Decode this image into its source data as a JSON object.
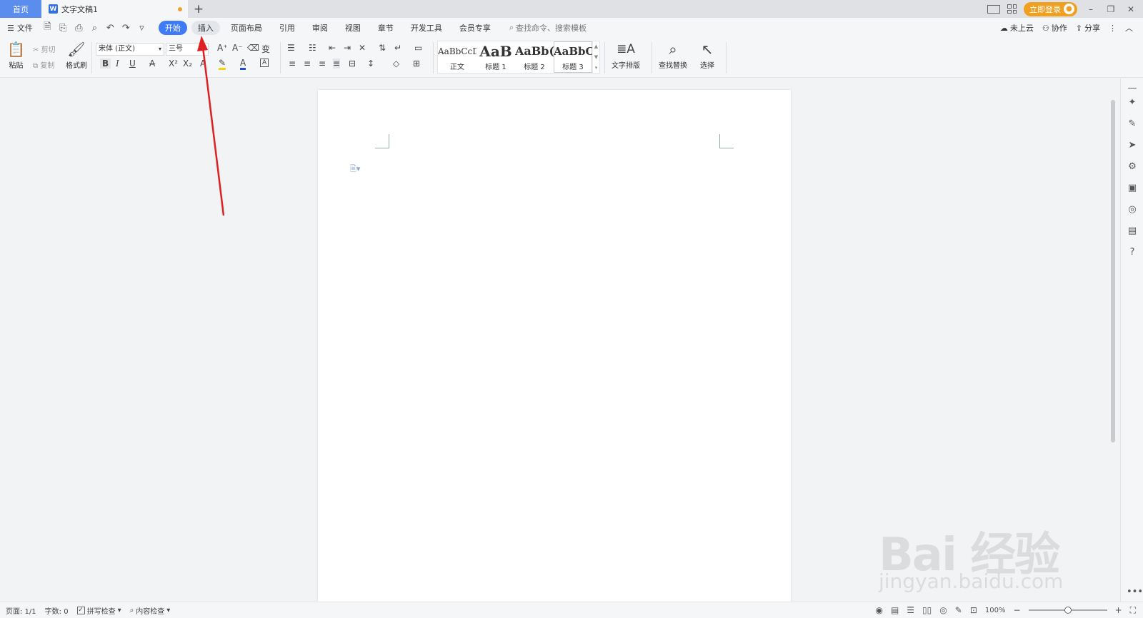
{
  "titlebar": {
    "home_tab": "首页",
    "doc_tab": "文字文稿1",
    "doc_icon": "W",
    "add_tab": "+",
    "login_button": "立即登录",
    "minimize": "–",
    "restore": "❐",
    "close": "✕"
  },
  "menu": {
    "file": "文件",
    "tabs": [
      "开始",
      "插入",
      "页面布局",
      "引用",
      "审阅",
      "视图",
      "章节",
      "开发工具",
      "会员专享"
    ],
    "active_tab": "开始",
    "search_placeholder": "查找命令、搜索模板",
    "unsaved_cloud": "未上云",
    "collaborate": "协作",
    "share": "分享"
  },
  "ribbon": {
    "paste": "粘贴",
    "cut": "剪切",
    "copy": "复制",
    "format_painter": "格式刷",
    "font_name": "宋体 (正文)",
    "font_size": "三号",
    "styles": [
      {
        "sample": "AaBbCcD",
        "caption": "正文"
      },
      {
        "sample": "AaB",
        "caption": "标题 1"
      },
      {
        "sample": "AaBb(",
        "caption": "标题 2"
      },
      {
        "sample": "AaBbC",
        "caption": "标题 3"
      }
    ],
    "text_layout": "文字排版",
    "find_replace": "查找替换",
    "select": "选择"
  },
  "status": {
    "page": "页面: 1/1",
    "word_count": "字数: 0",
    "spell_check": "拼写检查",
    "content_check": "内容检查",
    "zoom": "100%",
    "zoom_level": 0.5
  },
  "watermark": {
    "brand": "Bai  经验",
    "url": "jingyan.baidu.com"
  },
  "colors": {
    "accent": "#3e7bf5",
    "home_tab": "#5b8def",
    "login": "#f0a020",
    "arrow": "#e02020"
  }
}
